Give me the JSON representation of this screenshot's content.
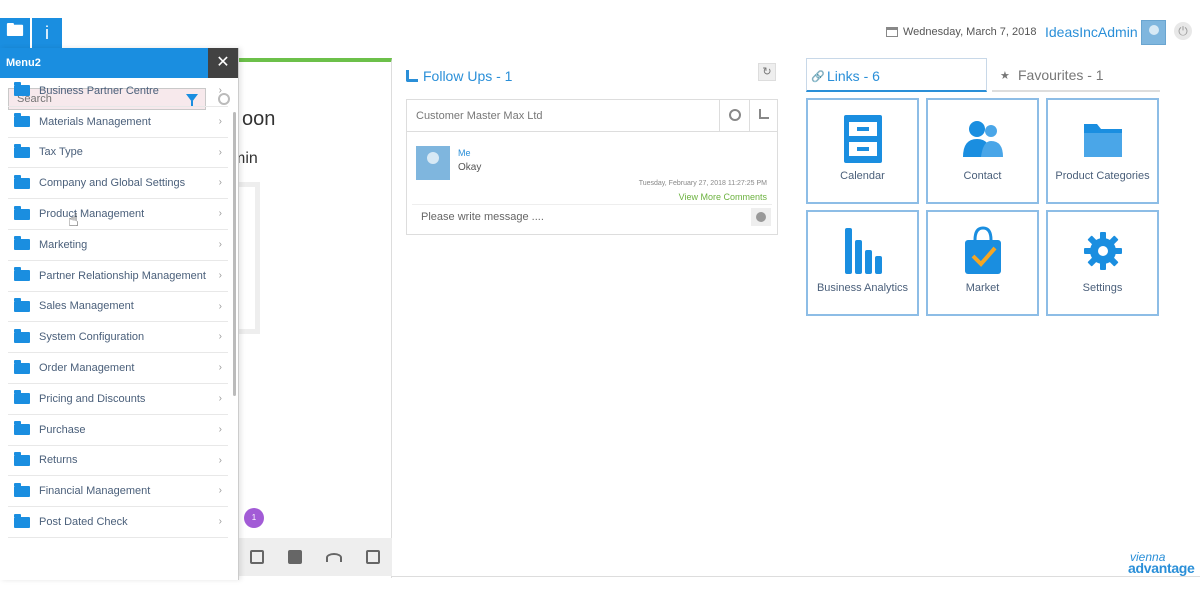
{
  "header": {
    "date": "Wednesday, March 7, 2018",
    "username": "IdeasIncAdmin"
  },
  "menu": {
    "title": "Menu2",
    "search_placeholder": "Search",
    "items": [
      {
        "label": "Business Partner Centre"
      },
      {
        "label": "Materials Management"
      },
      {
        "label": "Tax Type"
      },
      {
        "label": "Company and Global Settings"
      },
      {
        "label": "Product Management"
      },
      {
        "label": "Marketing"
      },
      {
        "label": "Partner Relationship Management"
      },
      {
        "label": "Sales Management"
      },
      {
        "label": "System Configuration"
      },
      {
        "label": "Order Management"
      },
      {
        "label": "Pricing and Discounts"
      },
      {
        "label": "Purchase"
      },
      {
        "label": "Returns"
      },
      {
        "label": "Financial Management"
      },
      {
        "label": "Post Dated Check"
      }
    ]
  },
  "greeting": {
    "line1": "oon",
    "line2": "min"
  },
  "notification_badge": "1",
  "follow_ups": {
    "title": "Follow Ups - 1",
    "record": "Customer Master  Max Ltd",
    "comment_author": "Me",
    "comment_text": "Okay",
    "comment_time": "Tuesday, February 27, 2018 11:27:25 PM",
    "view_more": "View More Comments",
    "message_placeholder": "Please write message ...."
  },
  "tabs": {
    "links": "Links - 6",
    "favourites": "Favourites - 1"
  },
  "tiles": [
    {
      "label": "Calendar",
      "icon": "cabinet-icon"
    },
    {
      "label": "Contact",
      "icon": "contact-icon"
    },
    {
      "label": "Product Categories",
      "icon": "folder-icon"
    },
    {
      "label": "Business Analytics",
      "icon": "bar-chart-icon"
    },
    {
      "label": "Market",
      "icon": "shopping-bag-icon"
    },
    {
      "label": "Settings",
      "icon": "gear-icon"
    }
  ],
  "logo": {
    "top": "vienna",
    "main": "advantage"
  },
  "colors": {
    "accent": "#1a8ee0",
    "green": "#6cc04a",
    "tile_border": "#8dbde6"
  }
}
